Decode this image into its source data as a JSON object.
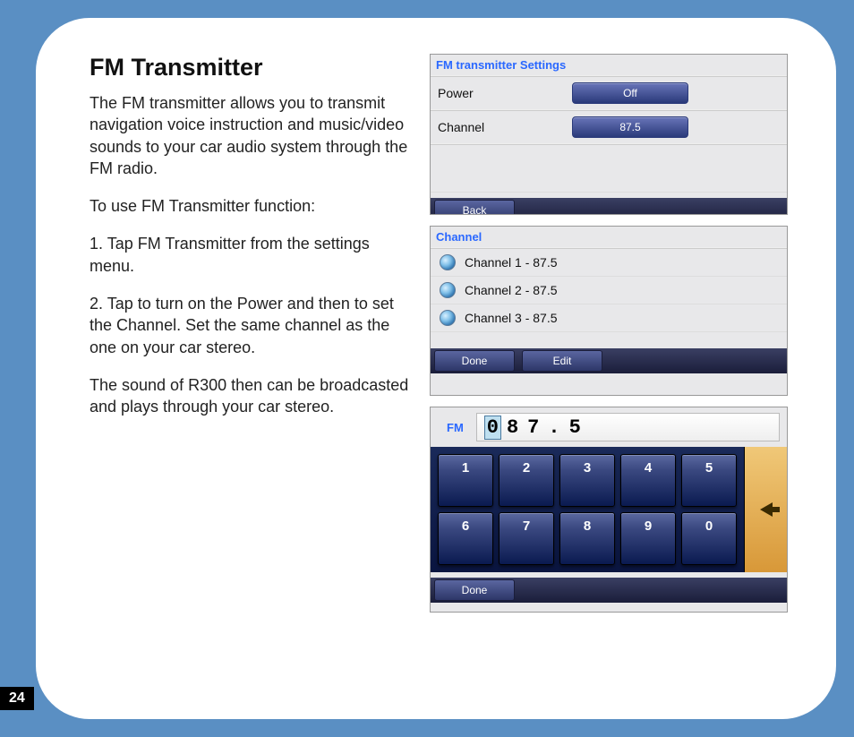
{
  "page_number": "24",
  "heading": "FM Transmitter",
  "paragraphs": [
    "The FM transmitter allows you to transmit navigation voice instruction and music/video sounds to your car audio system through the FM radio.",
    "To use FM Transmitter function:",
    "1. Tap FM Transmitter from the settings menu.",
    "2. Tap to turn on the Power and then to set the Channel. Set the same channel as the one on your car stereo.",
    "The sound of R300 then can be broadcasted and plays through your car stereo."
  ],
  "settings_panel": {
    "title": "FM transmitter Settings",
    "rows": [
      {
        "label": "Power",
        "value": "Off"
      },
      {
        "label": "Channel",
        "value": "87.5"
      }
    ],
    "back_button": "Back"
  },
  "channel_panel": {
    "title": "Channel",
    "items": [
      "Channel 1 - 87.5",
      "Channel 2 - 87.5",
      "Channel 3 - 87.5"
    ],
    "done_button": "Done",
    "edit_button": "Edit"
  },
  "keypad_panel": {
    "fm_label": "FM",
    "display_highlight": "0",
    "display_rest": "87.5",
    "keys": [
      "1",
      "2",
      "3",
      "4",
      "5",
      "6",
      "7",
      "8",
      "9",
      "0"
    ],
    "done_button": "Done"
  }
}
